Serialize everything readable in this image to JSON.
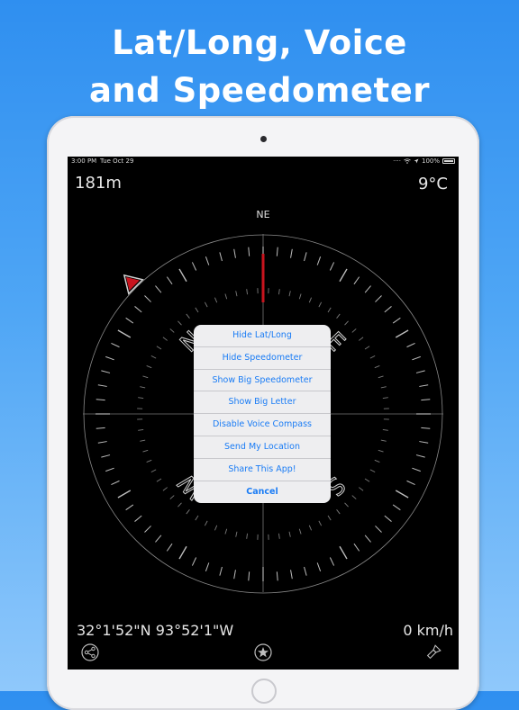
{
  "headline": {
    "line1": "Lat/Long, Voice",
    "line2": "and Speedometer"
  },
  "status_bar": {
    "time": "3:00 PM",
    "date": "Tue Oct 29",
    "battery": "100%"
  },
  "compass": {
    "altitude": "181m",
    "temperature": "9°C",
    "heading": "NE",
    "cardinals": {
      "n": "N",
      "e": "E",
      "s": "S",
      "w": "W"
    },
    "coordinates": "32°1'52\"N 93°52'1\"W",
    "speed": "0 km/h",
    "needle_color": "#c8141e",
    "marker_color": "#c8141e"
  },
  "action_sheet": {
    "items": [
      "Hide Lat/Long",
      "Hide Speedometer",
      "Show Big Speedometer",
      "Show Big Letter",
      "Disable Voice Compass",
      "Send My Location",
      "Share This App!"
    ],
    "cancel": "Cancel",
    "accent_color": "#1a7cf5"
  },
  "toolbar": {
    "icons": [
      "share-icon",
      "star-icon",
      "flashlight-icon"
    ]
  }
}
